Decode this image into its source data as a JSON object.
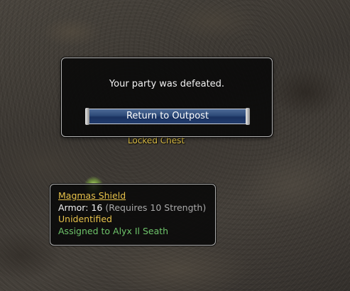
{
  "dialog": {
    "message": "Your party was defeated.",
    "button_label": "Return to Outpost"
  },
  "world_label": {
    "text": "Locked Chest"
  },
  "item_tooltip": {
    "name": "Magmas Shield",
    "armor_label": "Armor:",
    "armor_value": "16",
    "armor_requirement": "(Requires 10 Strength)",
    "status": "Unidentified",
    "assignment": "Assigned to Alyx Il Seath"
  },
  "colors": {
    "gold_text": "#e7c24a",
    "green_text": "#6ec36a",
    "button_blue": "#2d4a78",
    "panel_bg": "#080808"
  }
}
